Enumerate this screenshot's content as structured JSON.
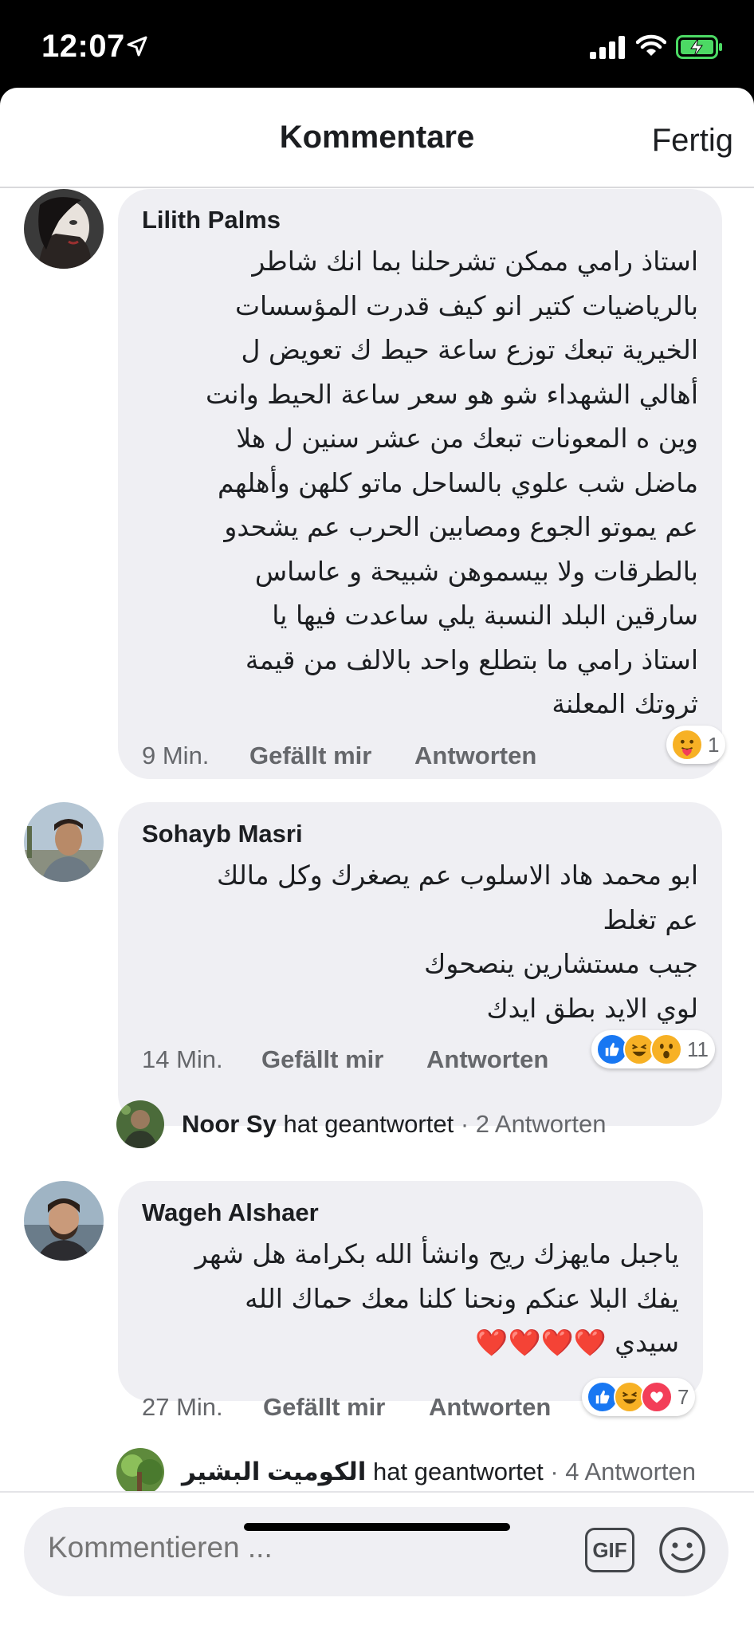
{
  "status_bar": {
    "time": "12:07"
  },
  "header": {
    "title": "Kommentare",
    "done_label": "Fertig"
  },
  "comments": [
    {
      "author": "Lilith Palms",
      "text": "استاذ رامي ممكن تشرحلنا بما انك شاطر\nبالرياضيات كتير انو كيف قدرت المؤسسات\nالخيرية تبعك توزع ساعة حيط ك تعويض ل\nأهالي الشهداء شو هو سعر ساعة الحيط وانت\nوين ه المعونات تبعك من عشر سنين ل هلا\nماضل شب علوي بالساحل ماتو كلهن وأهلهم\nعم يموتو الجوع  ومصابين الحرب عم يشحدو\nبالطرقات ولا بيسموهن شبيحة و عاساس\nسارقين البلد   النسبة يلي ساعدت فيها يا\nاستاذ رامي ما بتطلع واحد بالالف من قيمة\nثروتك المعلنة",
      "time": "9 Min.",
      "like_label": "Gefällt mir",
      "reply_label": "Antworten",
      "reaction_count": "1"
    },
    {
      "author": "Sohayb Masri",
      "text": "ابو محمد هاد الاسلوب عم يصغرك وكل مالك\nعم تغلط\nجيب مستشارين ينصحوك\nلوي الايد بطق ايدك",
      "time": "14 Min.",
      "like_label": "Gefällt mir",
      "reply_label": "Antworten",
      "reaction_count": "11",
      "reply_summary": {
        "name": "Noor Sy",
        "action": "hat geantwortet",
        "count": "· 2 Antworten"
      }
    },
    {
      "author": "Wageh Alshaer",
      "text": "ياجبل مايهزك ريح وانشأ الله بكرامة هل شهر\nيفك البلا عنكم ونحنا كلنا معك حماك الله\nسيدي ❤️❤️❤️❤️",
      "time": "27 Min.",
      "like_label": "Gefällt mir",
      "reply_label": "Antworten",
      "reaction_count": "7",
      "reply_summary": {
        "name": "الكوميت البشير",
        "action": "hat geantwortet",
        "count": "· 4 Antworten"
      }
    }
  ],
  "composer": {
    "placeholder": "Kommentieren ...",
    "gif_label": "GIF"
  },
  "icons": {
    "location": "location-arrow-icon",
    "signal": "cellular-signal-icon",
    "wifi": "wifi-icon",
    "battery": "battery-charging-icon",
    "emoji": "smiley-icon"
  },
  "colors": {
    "bubble": "#efeff3",
    "like_blue": "#1877f2",
    "love_red": "#f33e58",
    "haha_yellow": "#f7b125",
    "battery_green": "#4cd964"
  }
}
